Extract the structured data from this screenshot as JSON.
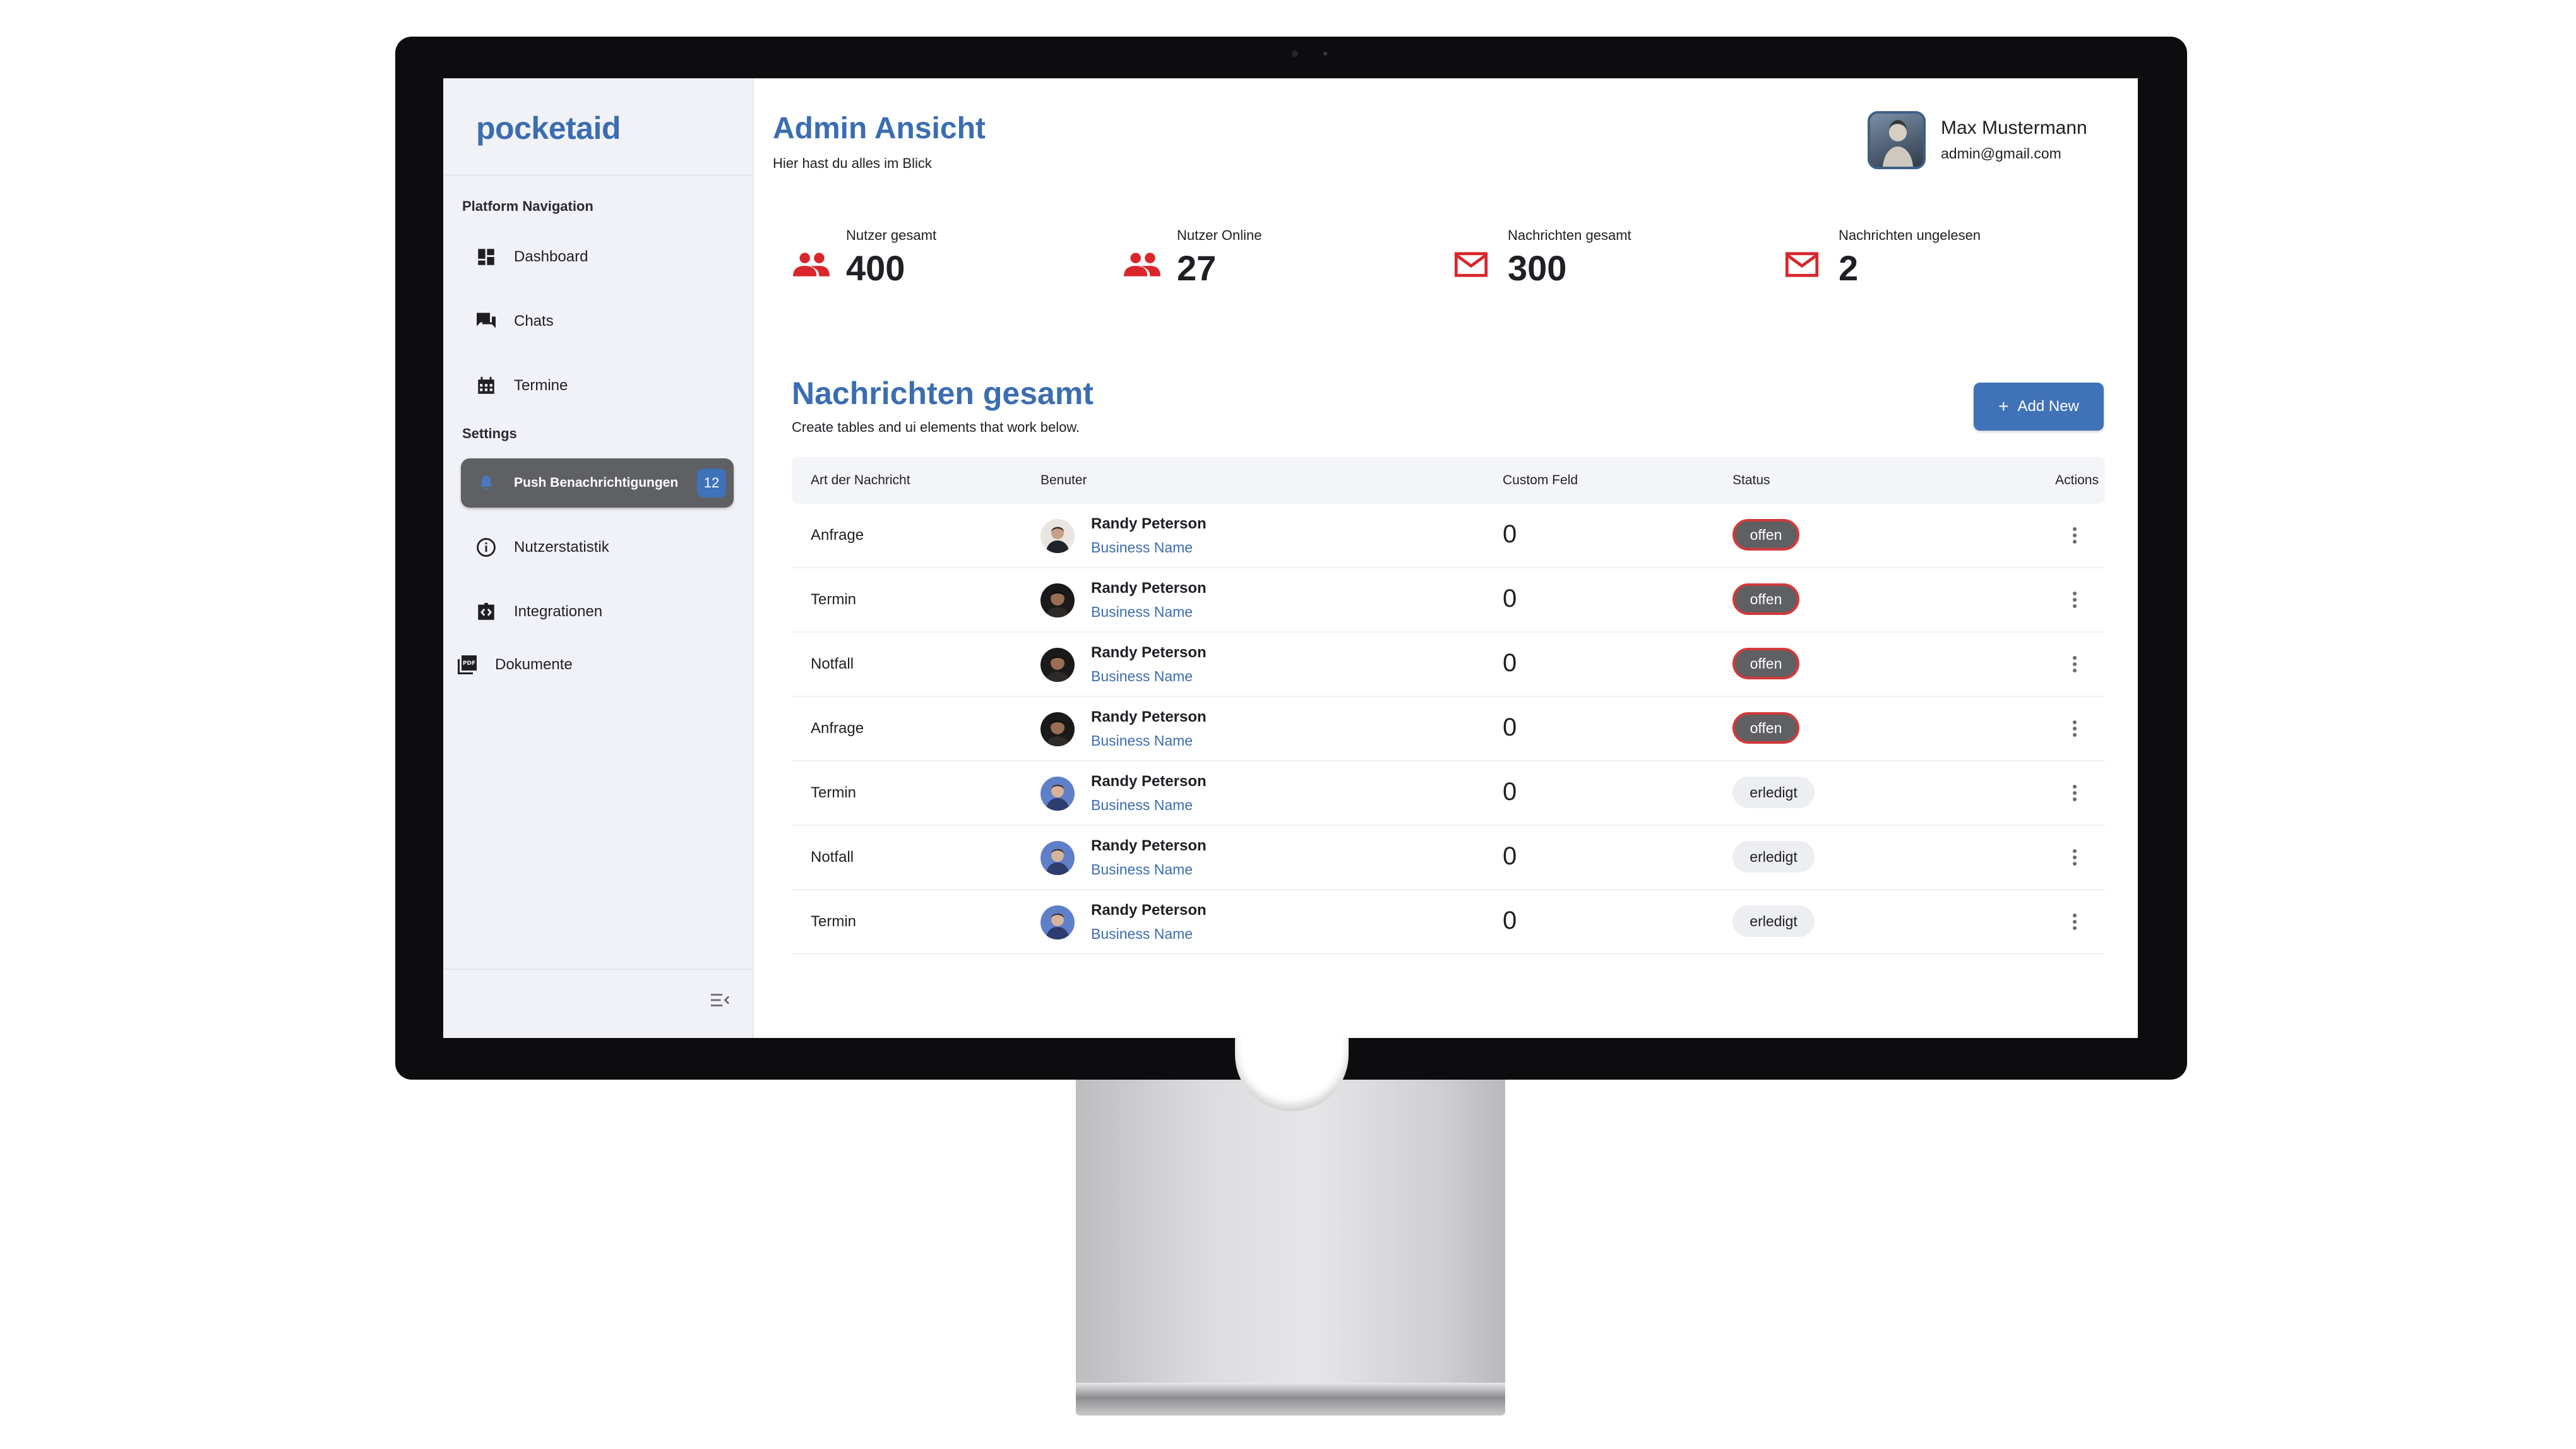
{
  "app": {
    "logo": "pocketaid"
  },
  "sidebar": {
    "nav_title": "Platform Navigation",
    "nav_items": [
      {
        "label": "Dashboard",
        "icon": "dashboard-icon"
      },
      {
        "label": "Chats",
        "icon": "chat-icon"
      },
      {
        "label": "Termine",
        "icon": "calendar-icon"
      }
    ],
    "settings_title": "Settings",
    "settings_items": [
      {
        "label": "Push Benachrichtigungen",
        "icon": "bell-icon",
        "badge": "12",
        "active": true
      },
      {
        "label": "Nutzerstatistik",
        "icon": "info-icon"
      },
      {
        "label": "Integrationen",
        "icon": "code-icon"
      },
      {
        "label": "Dokumente",
        "icon": "pdf-icon"
      }
    ]
  },
  "header": {
    "title": "Admin Ansicht",
    "subtitle": "Hier hast du alles im Blick",
    "user": {
      "name": "Max Mustermann",
      "email": "admin@gmail.com"
    }
  },
  "stats": [
    {
      "label": "Nutzer gesamt",
      "value": "400",
      "icon": "users-icon"
    },
    {
      "label": "Nutzer Online",
      "value": "27",
      "icon": "users-icon"
    },
    {
      "label": "Nachrichten gesamt",
      "value": "300",
      "icon": "mail-icon"
    },
    {
      "label": "Nachrichten ungelesen",
      "value": "2",
      "icon": "mail-icon"
    }
  ],
  "messages": {
    "title": "Nachrichten gesamt",
    "subtitle": "Create tables and ui elements that work below.",
    "add_button": "Add New",
    "columns": [
      "Art der Nachricht",
      "Benuter",
      "Custom Feld",
      "Status",
      "Actions"
    ],
    "rows": [
      {
        "type": "Anfrage",
        "name": "Randy Peterson",
        "business": "Business Name",
        "custom": "0",
        "status": "offen",
        "state": "open"
      },
      {
        "type": "Termin",
        "name": "Randy Peterson",
        "business": "Business Name",
        "custom": "0",
        "status": "offen",
        "state": "open"
      },
      {
        "type": "Notfall",
        "name": "Randy Peterson",
        "business": "Business Name",
        "custom": "0",
        "status": "offen",
        "state": "open"
      },
      {
        "type": "Anfrage",
        "name": "Randy Peterson",
        "business": "Business Name",
        "custom": "0",
        "status": "offen",
        "state": "open"
      },
      {
        "type": "Termin",
        "name": "Randy Peterson",
        "business": "Business Name",
        "custom": "0",
        "status": "erledigt",
        "state": "done"
      },
      {
        "type": "Notfall",
        "name": "Randy Peterson",
        "business": "Business Name",
        "custom": "0",
        "status": "erledigt",
        "state": "done"
      },
      {
        "type": "Termin",
        "name": "Randy Peterson",
        "business": "Business Name",
        "custom": "0",
        "status": "erledigt",
        "state": "done"
      }
    ]
  },
  "colors": {
    "brand": "#3b6db0",
    "accent_red": "#d9262b",
    "active_nav": "#5f6064",
    "badge": "#3f72b8"
  }
}
